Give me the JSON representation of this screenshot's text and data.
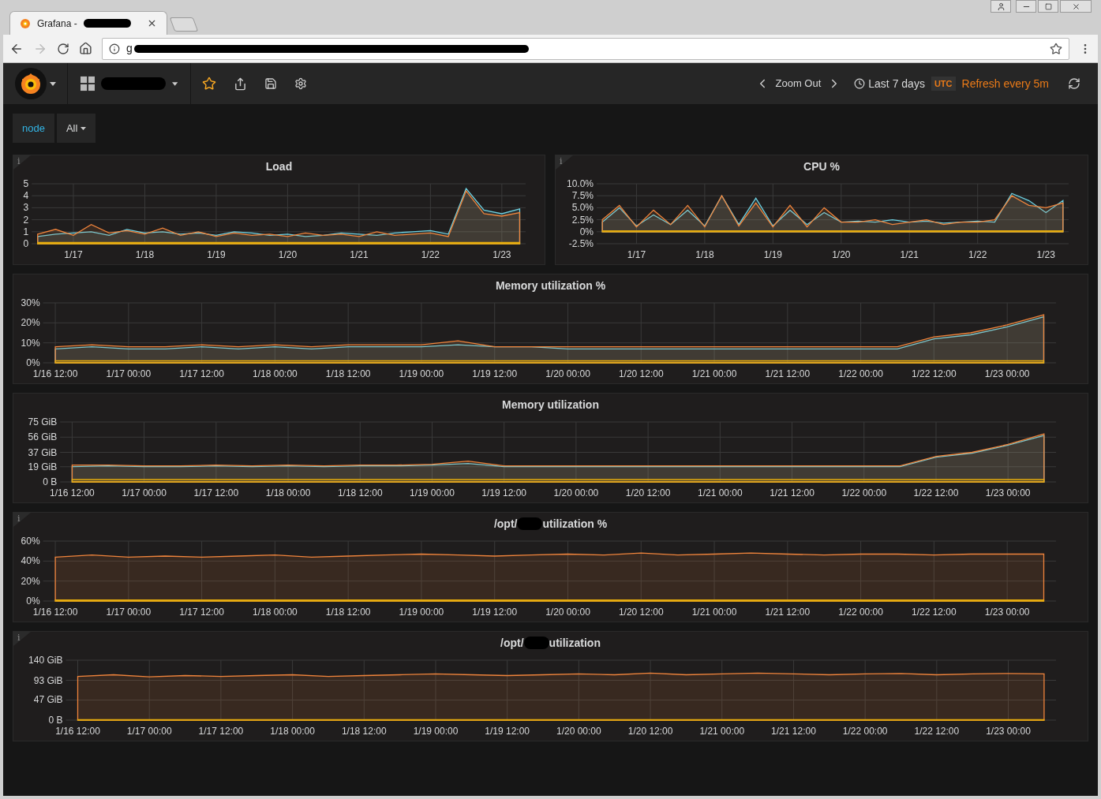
{
  "browser": {
    "tab_title": "Grafana -",
    "url_start": "g"
  },
  "navbar": {
    "zoom_out": "Zoom Out",
    "time_range": "Last 7 days",
    "timezone": "UTC",
    "refresh": "Refresh every 5m"
  },
  "variables": [
    {
      "label": "node",
      "value": "All"
    }
  ],
  "panels": [
    {
      "title_parts": [
        "Load"
      ],
      "info": "i",
      "chart_data": {
        "type": "area",
        "grid": true,
        "categories": [
          null,
          null,
          "1/17",
          null,
          null,
          null,
          "1/18",
          null,
          null,
          null,
          "1/19",
          null,
          null,
          null,
          "1/20",
          null,
          null,
          null,
          "1/21",
          null,
          null,
          null,
          "1/22",
          null,
          null,
          null,
          "1/23",
          null
        ],
        "ylim": [
          0,
          5
        ],
        "yticks": [
          0,
          1,
          2,
          3,
          4,
          5
        ],
        "series": [
          {
            "color": "#6ed0e0",
            "values": [
              0.6,
              0.8,
              0.9,
              1.0,
              0.7,
              1.2,
              0.9,
              1.0,
              0.8,
              0.9,
              0.7,
              1.0,
              0.9,
              0.7,
              0.8,
              0.6,
              0.7,
              0.9,
              0.8,
              0.7,
              0.9,
              1.0,
              1.1,
              0.8,
              4.6,
              2.8,
              2.5,
              2.9
            ]
          },
          {
            "color": "#ef843c",
            "values": [
              0.8,
              1.2,
              0.7,
              1.6,
              0.9,
              1.1,
              0.8,
              1.3,
              0.7,
              1.0,
              0.6,
              0.9,
              0.7,
              0.8,
              0.6,
              0.9,
              0.7,
              0.8,
              0.6,
              1.0,
              0.7,
              0.8,
              0.9,
              0.6,
              4.4,
              2.5,
              2.3,
              2.6
            ]
          },
          {
            "color": "#e5ac0e",
            "values": [
              0.1,
              0.1,
              0.1,
              0.1,
              0.1,
              0.1,
              0.1,
              0.1,
              0.1,
              0.1,
              0.1,
              0.1,
              0.1,
              0.1,
              0.1,
              0.1,
              0.1,
              0.1,
              0.1,
              0.1,
              0.1,
              0.1,
              0.1,
              0.1,
              0.1,
              0.1,
              0.1,
              0.1
            ]
          }
        ]
      }
    },
    {
      "title_parts": [
        "CPU %"
      ],
      "info": "i",
      "chart_data": {
        "type": "area",
        "grid": true,
        "categories": [
          null,
          null,
          "1/17",
          null,
          null,
          null,
          "1/18",
          null,
          null,
          null,
          "1/19",
          null,
          null,
          null,
          "1/20",
          null,
          null,
          null,
          "1/21",
          null,
          null,
          null,
          "1/22",
          null,
          null,
          null,
          "1/23",
          null
        ],
        "ylim": [
          -2.5,
          10
        ],
        "yticks": [
          {
            "value": -2.5,
            "label": "-2.5%"
          },
          {
            "value": 0,
            "label": "0%"
          },
          {
            "value": 2.5,
            "label": "2.5%"
          },
          {
            "value": 5,
            "label": "5.0%"
          },
          {
            "value": 7.5,
            "label": "7.5%"
          },
          {
            "value": 10,
            "label": "10.0%"
          }
        ],
        "series": [
          {
            "color": "#6ed0e0",
            "values": [
              2.0,
              5.0,
              1.2,
              3.5,
              1.5,
              4.5,
              1.2,
              7.5,
              1.5,
              7.0,
              1.2,
              4.5,
              1.5,
              4.0,
              2.0,
              2.2,
              2.0,
              2.5,
              2.0,
              2.2,
              1.8,
              2.0,
              2.2,
              2.0,
              8.0,
              6.5,
              4.0,
              6.5
            ]
          },
          {
            "color": "#ef843c",
            "values": [
              2.5,
              5.5,
              1.0,
              4.5,
              1.5,
              5.5,
              1.0,
              7.5,
              1.2,
              6.0,
              1.0,
              5.5,
              1.0,
              5.0,
              2.0,
              2.0,
              2.5,
              1.5,
              2.0,
              2.5,
              1.5,
              2.0,
              2.0,
              2.5,
              7.5,
              5.5,
              5.0,
              6.0
            ]
          },
          {
            "color": "#e5ac0e",
            "values": [
              0.2,
              0.2,
              0.2,
              0.2,
              0.2,
              0.2,
              0.2,
              0.2,
              0.2,
              0.2,
              0.2,
              0.2,
              0.2,
              0.2,
              0.2,
              0.2,
              0.2,
              0.2,
              0.2,
              0.2,
              0.2,
              0.2,
              0.2,
              0.2,
              0.2,
              0.2,
              0.2,
              0.2
            ]
          }
        ]
      }
    },
    {
      "title_parts": [
        "Memory utilization %"
      ],
      "chart_data": {
        "type": "area",
        "grid": true,
        "categories": [
          "1/16 12:00",
          null,
          "1/17 00:00",
          null,
          "1/17 12:00",
          null,
          "1/18 00:00",
          null,
          "1/18 12:00",
          null,
          "1/19 00:00",
          null,
          "1/19 12:00",
          null,
          "1/20 00:00",
          null,
          "1/20 12:00",
          null,
          "1/21 00:00",
          null,
          "1/21 12:00",
          null,
          "1/22 00:00",
          null,
          "1/22 12:00",
          null,
          "1/23 00:00",
          null
        ],
        "ylim": [
          0,
          30
        ],
        "yticks": [
          {
            "value": 0,
            "label": "0%"
          },
          {
            "value": 10,
            "label": "10%"
          },
          {
            "value": 20,
            "label": "20%"
          },
          {
            "value": 30,
            "label": "30%"
          }
        ],
        "series": [
          {
            "color": "#6ed0e0",
            "values": [
              7,
              8,
              7,
              7,
              8,
              7,
              8,
              7,
              8,
              8,
              8,
              9,
              8,
              8,
              7,
              7,
              7,
              7,
              7,
              7,
              7,
              7,
              7,
              7,
              12,
              14,
              18,
              23
            ]
          },
          {
            "color": "#ef843c",
            "values": [
              8,
              9,
              8,
              8,
              9,
              8,
              9,
              8,
              9,
              9,
              9,
              11,
              8,
              8,
              8,
              8,
              8,
              8,
              8,
              8,
              8,
              8,
              8,
              8,
              13,
              15,
              19,
              24
            ]
          },
          {
            "color": "#e5ac0e",
            "values": [
              1,
              1,
              1,
              1,
              1,
              1,
              1,
              1,
              1,
              1,
              1,
              1,
              1,
              1,
              1,
              1,
              1,
              1,
              1,
              1,
              1,
              1,
              1,
              1,
              1,
              1,
              1,
              1
            ]
          }
        ]
      }
    },
    {
      "title_parts": [
        "Memory utilization"
      ],
      "chart_data": {
        "type": "area",
        "grid": true,
        "categories": [
          "1/16 12:00",
          null,
          "1/17 00:00",
          null,
          "1/17 12:00",
          null,
          "1/18 00:00",
          null,
          "1/18 12:00",
          null,
          "1/19 00:00",
          null,
          "1/19 12:00",
          null,
          "1/20 00:00",
          null,
          "1/20 12:00",
          null,
          "1/21 00:00",
          null,
          "1/21 12:00",
          null,
          "1/22 00:00",
          null,
          "1/22 12:00",
          null,
          "1/23 00:00",
          null
        ],
        "ylim": [
          0,
          75
        ],
        "yticks": [
          {
            "value": 0,
            "label": "0 B"
          },
          {
            "value": 19,
            "label": "19 GiB"
          },
          {
            "value": 37,
            "label": "37 GiB"
          },
          {
            "value": 56,
            "label": "56 GiB"
          },
          {
            "value": 75,
            "label": "75 GiB"
          }
        ],
        "series": [
          {
            "color": "#6ed0e0",
            "values": [
              19,
              20,
              19,
              19,
              20,
              19,
              20,
              19,
              20,
              20,
              21,
              23,
              19,
              19,
              19,
              19,
              19,
              19,
              19,
              19,
              19,
              19,
              19,
              19,
              31,
              36,
              46,
              58
            ]
          },
          {
            "color": "#ef843c",
            "values": [
              21,
              21,
              20,
              20,
              21,
              20,
              21,
              20,
              21,
              21,
              22,
              26,
              20,
              20,
              20,
              20,
              20,
              20,
              20,
              20,
              20,
              20,
              20,
              20,
              32,
              37,
              47,
              60
            ]
          },
          {
            "color": "#e5ac0e",
            "values": [
              3,
              3,
              3,
              3,
              3,
              3,
              3,
              3,
              3,
              3,
              3,
              3,
              3,
              3,
              3,
              3,
              3,
              3,
              3,
              3,
              3,
              3,
              3,
              3,
              3,
              3,
              3,
              3
            ]
          }
        ]
      }
    },
    {
      "title_parts": [
        "/opt/",
        "utilization %"
      ],
      "info": "i",
      "chart_data": {
        "type": "area",
        "grid": true,
        "categories": [
          "1/16 12:00",
          null,
          "1/17 00:00",
          null,
          "1/17 12:00",
          null,
          "1/18 00:00",
          null,
          "1/18 12:00",
          null,
          "1/19 00:00",
          null,
          "1/19 12:00",
          null,
          "1/20 00:00",
          null,
          "1/20 12:00",
          null,
          "1/21 00:00",
          null,
          "1/21 12:00",
          null,
          "1/22 00:00",
          null,
          "1/22 12:00",
          null,
          "1/23 00:00",
          null
        ],
        "ylim": [
          0,
          60
        ],
        "yticks": [
          {
            "value": 0,
            "label": "0%"
          },
          {
            "value": 20,
            "label": "20%"
          },
          {
            "value": 40,
            "label": "40%"
          },
          {
            "value": 60,
            "label": "60%"
          }
        ],
        "series": [
          {
            "color": "#ef843c",
            "values": [
              44,
              46,
              44,
              45,
              44,
              45,
              46,
              44,
              45,
              46,
              47,
              46,
              45,
              46,
              47,
              46,
              48,
              46,
              47,
              48,
              47,
              46,
              47,
              47,
              46,
              47,
              47,
              47
            ]
          },
          {
            "color": "#e5ac0e",
            "values": [
              1,
              1,
              1,
              1,
              1,
              1,
              1,
              1,
              1,
              1,
              1,
              1,
              1,
              1,
              1,
              1,
              1,
              1,
              1,
              1,
              1,
              1,
              1,
              1,
              1,
              1,
              1,
              1
            ]
          }
        ]
      }
    },
    {
      "title_parts": [
        "/opt/",
        "utilization"
      ],
      "info": "i",
      "chart_data": {
        "type": "area",
        "grid": true,
        "categories": [
          "1/16 12:00",
          null,
          "1/17 00:00",
          null,
          "1/17 12:00",
          null,
          "1/18 00:00",
          null,
          "1/18 12:00",
          null,
          "1/19 00:00",
          null,
          "1/19 12:00",
          null,
          "1/20 00:00",
          null,
          "1/20 12:00",
          null,
          "1/21 00:00",
          null,
          "1/21 12:00",
          null,
          "1/22 00:00",
          null,
          "1/22 12:00",
          null,
          "1/23 00:00",
          null
        ],
        "ylim": [
          0,
          140
        ],
        "yticks": [
          {
            "value": 0,
            "label": "0 B"
          },
          {
            "value": 47,
            "label": "47 GiB"
          },
          {
            "value": 93,
            "label": "93 GiB"
          },
          {
            "value": 140,
            "label": "140 GiB"
          }
        ],
        "series": [
          {
            "color": "#ef843c",
            "values": [
              102,
              106,
              101,
              104,
              102,
              104,
              106,
              102,
              104,
              106,
              108,
              106,
              104,
              106,
              108,
              106,
              110,
              106,
              108,
              110,
              108,
              106,
              108,
              109,
              106,
              108,
              109,
              108
            ]
          },
          {
            "color": "#e5ac0e",
            "values": [
              1,
              1,
              1,
              1,
              1,
              1,
              1,
              1,
              1,
              1,
              1,
              1,
              1,
              1,
              1,
              1,
              1,
              1,
              1,
              1,
              1,
              1,
              1,
              1,
              1,
              1,
              1,
              1
            ]
          }
        ]
      }
    }
  ]
}
